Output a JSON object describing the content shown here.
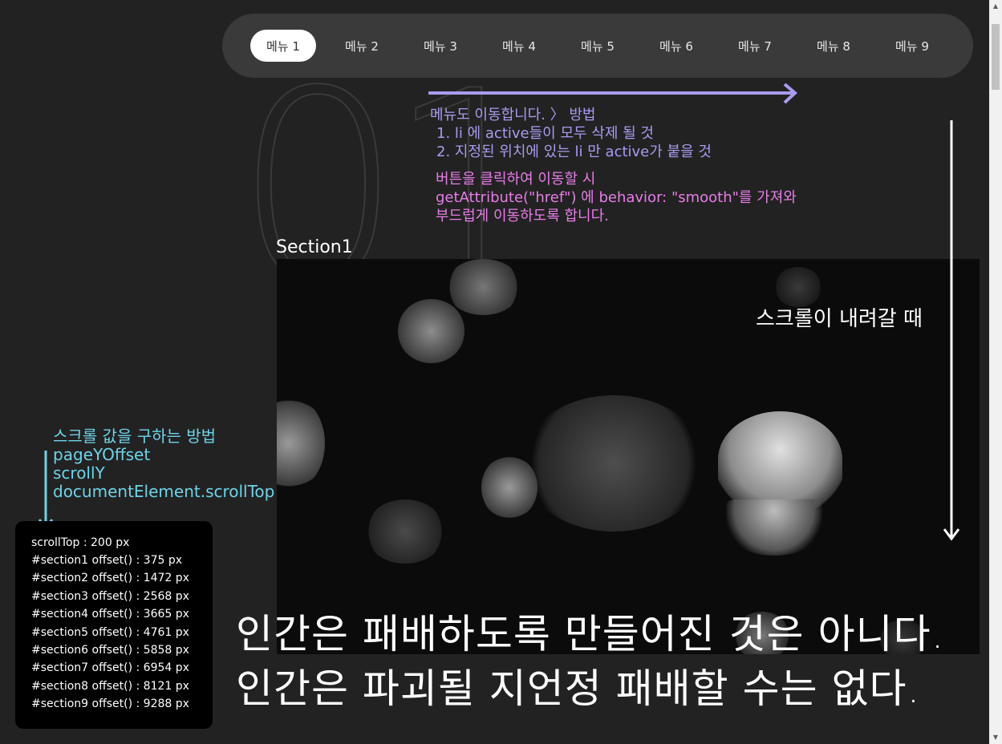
{
  "background_number": "01",
  "nav": {
    "items": [
      {
        "label": "메뉴 1",
        "active": true
      },
      {
        "label": "메뉴 2",
        "active": false
      },
      {
        "label": "메뉴 3",
        "active": false
      },
      {
        "label": "메뉴 4",
        "active": false
      },
      {
        "label": "메뉴 5",
        "active": false
      },
      {
        "label": "메뉴 6",
        "active": false
      },
      {
        "label": "메뉴 7",
        "active": false
      },
      {
        "label": "메뉴 8",
        "active": false
      },
      {
        "label": "메뉴 9",
        "active": false
      }
    ]
  },
  "notes": {
    "menu_title": "메뉴도 이동합니다. 〉 방법",
    "menu_step1": "1.  li 에 active들이 모두 삭제 될 것",
    "menu_step2": "2.  지정된 위치에 있는 li 만 active가 붙을 것",
    "click_line1": "버튼을 클릭하여 이동할 시",
    "click_line2": "getAttribute(\"href\") 에 behavior: \"smooth\"를 가져와",
    "click_line3": "부드럽게 이동하도록 합니다.",
    "scroll_down": "스크롤이 내려갈 때",
    "scroll_method_title": "스크롤 값을 구하는 방법",
    "scroll_method_1": "pageYOffset",
    "scroll_method_2": "scrollY",
    "scroll_method_3": "documentElement.scrollTop"
  },
  "section": {
    "title": "Section1",
    "quote_line1": "인간은 패배하도록 만들어진 것은 아니다.",
    "quote_line2": "인간은 파괴될 지언정 패배할 수는 없다."
  },
  "info": {
    "rows": [
      "scrollTop : 200 px",
      "#section1 offset() : 375 px",
      "#section2 offset() : 1472 px",
      "#section3 offset() : 2568 px",
      "#section4 offset() : 3665 px",
      "#section5 offset() : 4761 px",
      "#section6 offset() : 5858 px",
      "#section7 offset() : 6954 px",
      "#section8 offset() : 8121 px",
      "#section9 offset() : 9288 px"
    ]
  },
  "colors": {
    "background": "#222222",
    "nav_bg": "#3a3a3a",
    "note_purple": "#a99bf0",
    "note_pink": "#e87de8",
    "note_cyan": "#6fd3e8"
  }
}
